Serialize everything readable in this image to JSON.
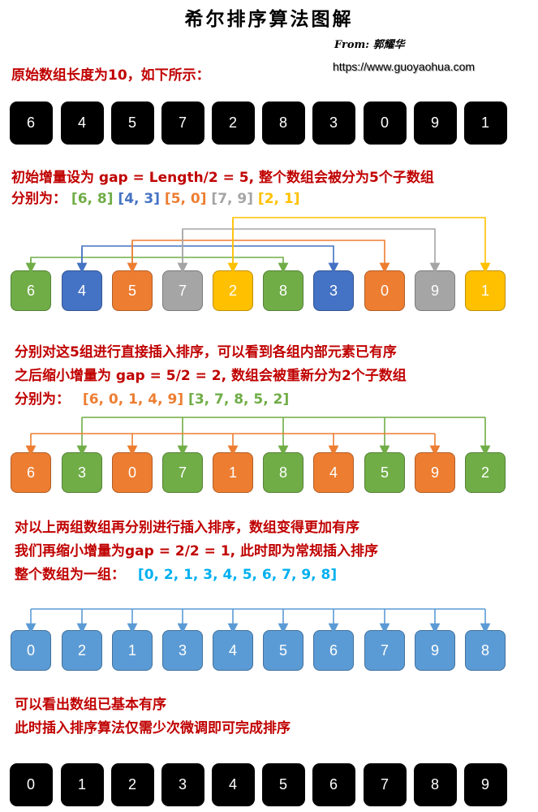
{
  "header": {
    "title": "希尔排序算法图解",
    "author": "From: 郭耀华",
    "url": "https://www.guoyaohua.com"
  },
  "steps": {
    "s1": {
      "line1": "原始数组长度为10，如下所示："
    },
    "s2": {
      "line1": "初始增量设为 gap = Length/2 = 5, 整个数组会被分为5个子数组",
      "line2_prefix": "分别为：",
      "groups": [
        "[6, 8]",
        "[4, 3]",
        "[5, 0]",
        "[7, 9]",
        "[2, 1]"
      ]
    },
    "s3": {
      "line1": "分别对这5组进行直接插入排序，可以看到各组内部元素已有序",
      "line2": "之后缩小增量为 gap = 5/2 = 2, 数组会被重新分为2个子数组",
      "line3_prefix": "分别为：",
      "groups": [
        "[6, 0, 1, 4, 9]",
        "[3, 7, 8, 5, 2]"
      ]
    },
    "s4": {
      "line1": "对以上两组数组再分别进行插入排序，数组变得更加有序",
      "line2": "我们再缩小增量为gap = 2/2 = 1, 此时即为常规插入排序",
      "line3_prefix": "整个数组为一组：",
      "group": "[0, 2, 1, 3, 4, 5, 6, 7, 9, 8]"
    },
    "s5": {
      "line1": "可以看出数组已基本有序",
      "line2": "此时插入排序算法仅需少次微调即可完成排序"
    }
  },
  "colors": {
    "text_red": "#c00000",
    "green": "#70ad47",
    "blue": "#4472c4",
    "orange": "#ed7d31",
    "gray": "#a5a5a5",
    "yellow": "#ffc000",
    "light_blue": "#5b9bd5",
    "group_text_blue": "#00b0f0"
  },
  "arrays": {
    "original": [
      6,
      4,
      5,
      7,
      2,
      8,
      3,
      0,
      9,
      1
    ],
    "gap5_colors": [
      "green",
      "blue",
      "orange",
      "gray",
      "yellow",
      "green",
      "blue",
      "orange",
      "gray",
      "yellow"
    ],
    "after_gap5": [
      6,
      3,
      0,
      7,
      1,
      8,
      4,
      5,
      9,
      2
    ],
    "gap2_colors": [
      "orange",
      "green",
      "orange",
      "green",
      "orange",
      "green",
      "orange",
      "green",
      "orange",
      "green"
    ],
    "after_gap2": [
      0,
      2,
      1,
      3,
      4,
      5,
      6,
      7,
      9,
      8
    ],
    "sorted": [
      0,
      1,
      2,
      3,
      4,
      5,
      6,
      7,
      8,
      9
    ]
  }
}
